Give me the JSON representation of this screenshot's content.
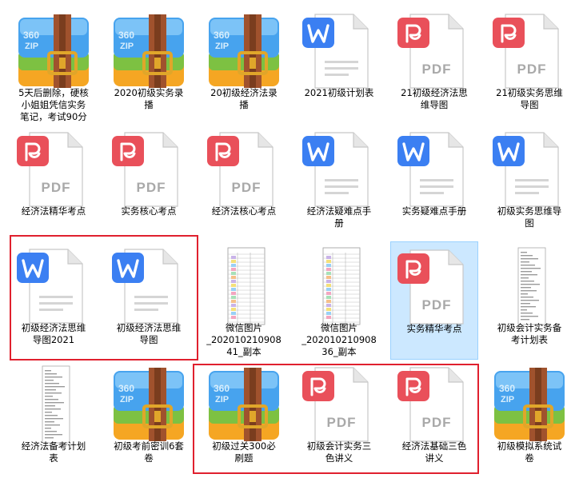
{
  "files": [
    {
      "name": "5天后删除，硬核小姐姐凭信实务笔记，考试90分",
      "type": "zip",
      "row": 0,
      "col": 0
    },
    {
      "name": "2020初级实务录播",
      "type": "zip",
      "row": 0,
      "col": 1
    },
    {
      "name": "20初级经济法录播",
      "type": "zip",
      "row": 0,
      "col": 2
    },
    {
      "name": "2021初级计划表",
      "type": "word",
      "row": 0,
      "col": 3
    },
    {
      "name": "21初级经济法思维导图",
      "type": "pdf",
      "row": 0,
      "col": 4
    },
    {
      "name": "21初级实务思维导图",
      "type": "pdf",
      "row": 0,
      "col": 5
    },
    {
      "name": "经济法精华考点",
      "type": "pdf",
      "row": 1,
      "col": 0
    },
    {
      "name": "实务核心考点",
      "type": "pdf",
      "row": 1,
      "col": 1
    },
    {
      "name": "经济法核心考点",
      "type": "pdf",
      "row": 1,
      "col": 2
    },
    {
      "name": "经济法疑难点手册",
      "type": "word",
      "row": 1,
      "col": 3
    },
    {
      "name": "实务疑难点手册",
      "type": "word",
      "row": 1,
      "col": 4
    },
    {
      "name": "初级实务思维导图",
      "type": "word",
      "row": 1,
      "col": 5
    },
    {
      "name": "初级经济法思维导图2021",
      "type": "word",
      "row": 2,
      "col": 0
    },
    {
      "name": "初级经济法思维导图",
      "type": "word",
      "row": 2,
      "col": 1
    },
    {
      "name": "微信图片_20201021090841_副本",
      "type": "image-table",
      "row": 2,
      "col": 2
    },
    {
      "name": "微信图片_20201021090836_副本",
      "type": "image-table",
      "row": 2,
      "col": 3
    },
    {
      "name": "实务精华考点",
      "type": "pdf",
      "row": 2,
      "col": 4,
      "selected": true
    },
    {
      "name": "初级会计实务备考计划表",
      "type": "image-doc",
      "row": 2,
      "col": 5
    },
    {
      "name": "经济法备考计划表",
      "type": "image-doc",
      "row": 3,
      "col": 0
    },
    {
      "name": "初级考前密训6套卷",
      "type": "zip",
      "row": 3,
      "col": 1
    },
    {
      "name": "初级过关300必刷题",
      "type": "zip",
      "row": 3,
      "col": 2
    },
    {
      "name": "初级会计实务三色讲义",
      "type": "pdf",
      "row": 3,
      "col": 3
    },
    {
      "name": "经济法基础三色讲义",
      "type": "pdf",
      "row": 3,
      "col": 4
    },
    {
      "name": "初级模拟系统试卷",
      "type": "zip",
      "row": 3,
      "col": 5
    }
  ],
  "labels_display": [
    "5天后删除，硬核\n小姐姐凭信实务\n笔记，考试90分",
    "2020初级实务录\n播",
    "20初级经济法录\n播",
    "2021初级计划表",
    "21初级经济法思\n维导图",
    "21初级实务思维\n导图",
    "经济法精华考点",
    "实务核心考点",
    "经济法核心考点",
    "经济法疑难点手\n册",
    "实务疑难点手册",
    "初级实务思维导\n图",
    "初级经济法思维\n导图2021",
    "初级经济法思维\n导图",
    "微信图片\n_202010210908\n41_副本",
    "微信图片\n_202010210908\n36_副本",
    "实务精华考点",
    "初级会计实务备\n考计划表",
    "经济法备考计划\n表",
    "初级考前密训6套\n卷",
    "初级过关300必\n刷题",
    "初级会计实务三\n色讲义",
    "经济法基础三色\n讲义",
    "初级模拟系统试\n卷"
  ],
  "icon_text": {
    "zip": "360\nZIP",
    "pdf": "PDF",
    "word": "W"
  },
  "colors": {
    "pdf_red": "#e9505a",
    "word_blue": "#3b7ff2",
    "selection": "#cce8ff",
    "highlight_border": "#e0202e",
    "zip_blue": "#47a3ee",
    "zip_green": "#7dc142",
    "zip_orange": "#f5a623",
    "zip_belt": "#a0522d"
  },
  "highlight_groups": [
    "row2-col0-col1",
    "row3-col2-col4"
  ]
}
